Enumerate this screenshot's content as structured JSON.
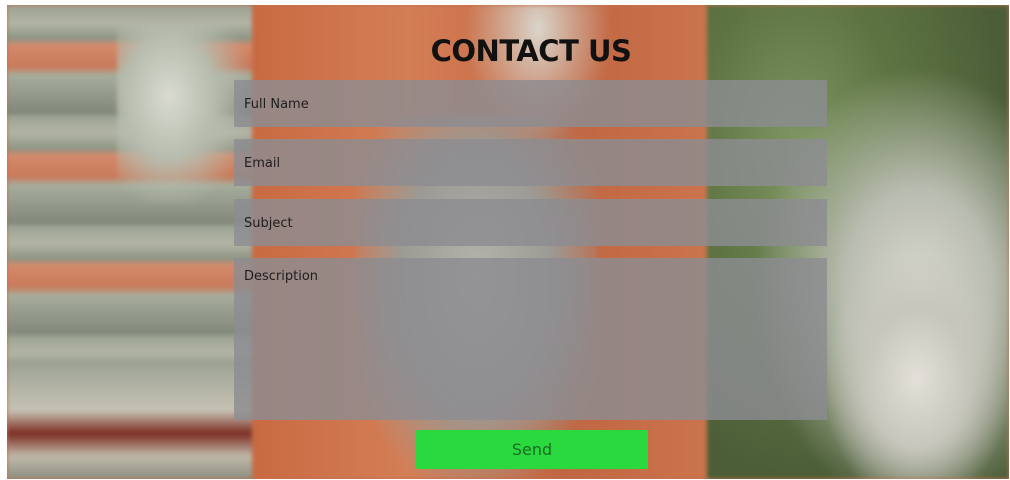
{
  "page": {
    "title": "CONTACT US"
  },
  "form": {
    "full_name": {
      "placeholder": "Full Name",
      "value": ""
    },
    "email": {
      "placeholder": "Email",
      "value": ""
    },
    "subject": {
      "placeholder": "Subject",
      "value": ""
    },
    "description": {
      "placeholder": "Description",
      "value": ""
    },
    "send_label": "Send"
  },
  "colors": {
    "field_background": "#8c8c91",
    "send_button": "#2ad93e",
    "title_text": "#111111"
  },
  "background": {
    "description_icon": "temple-carving-photo"
  }
}
